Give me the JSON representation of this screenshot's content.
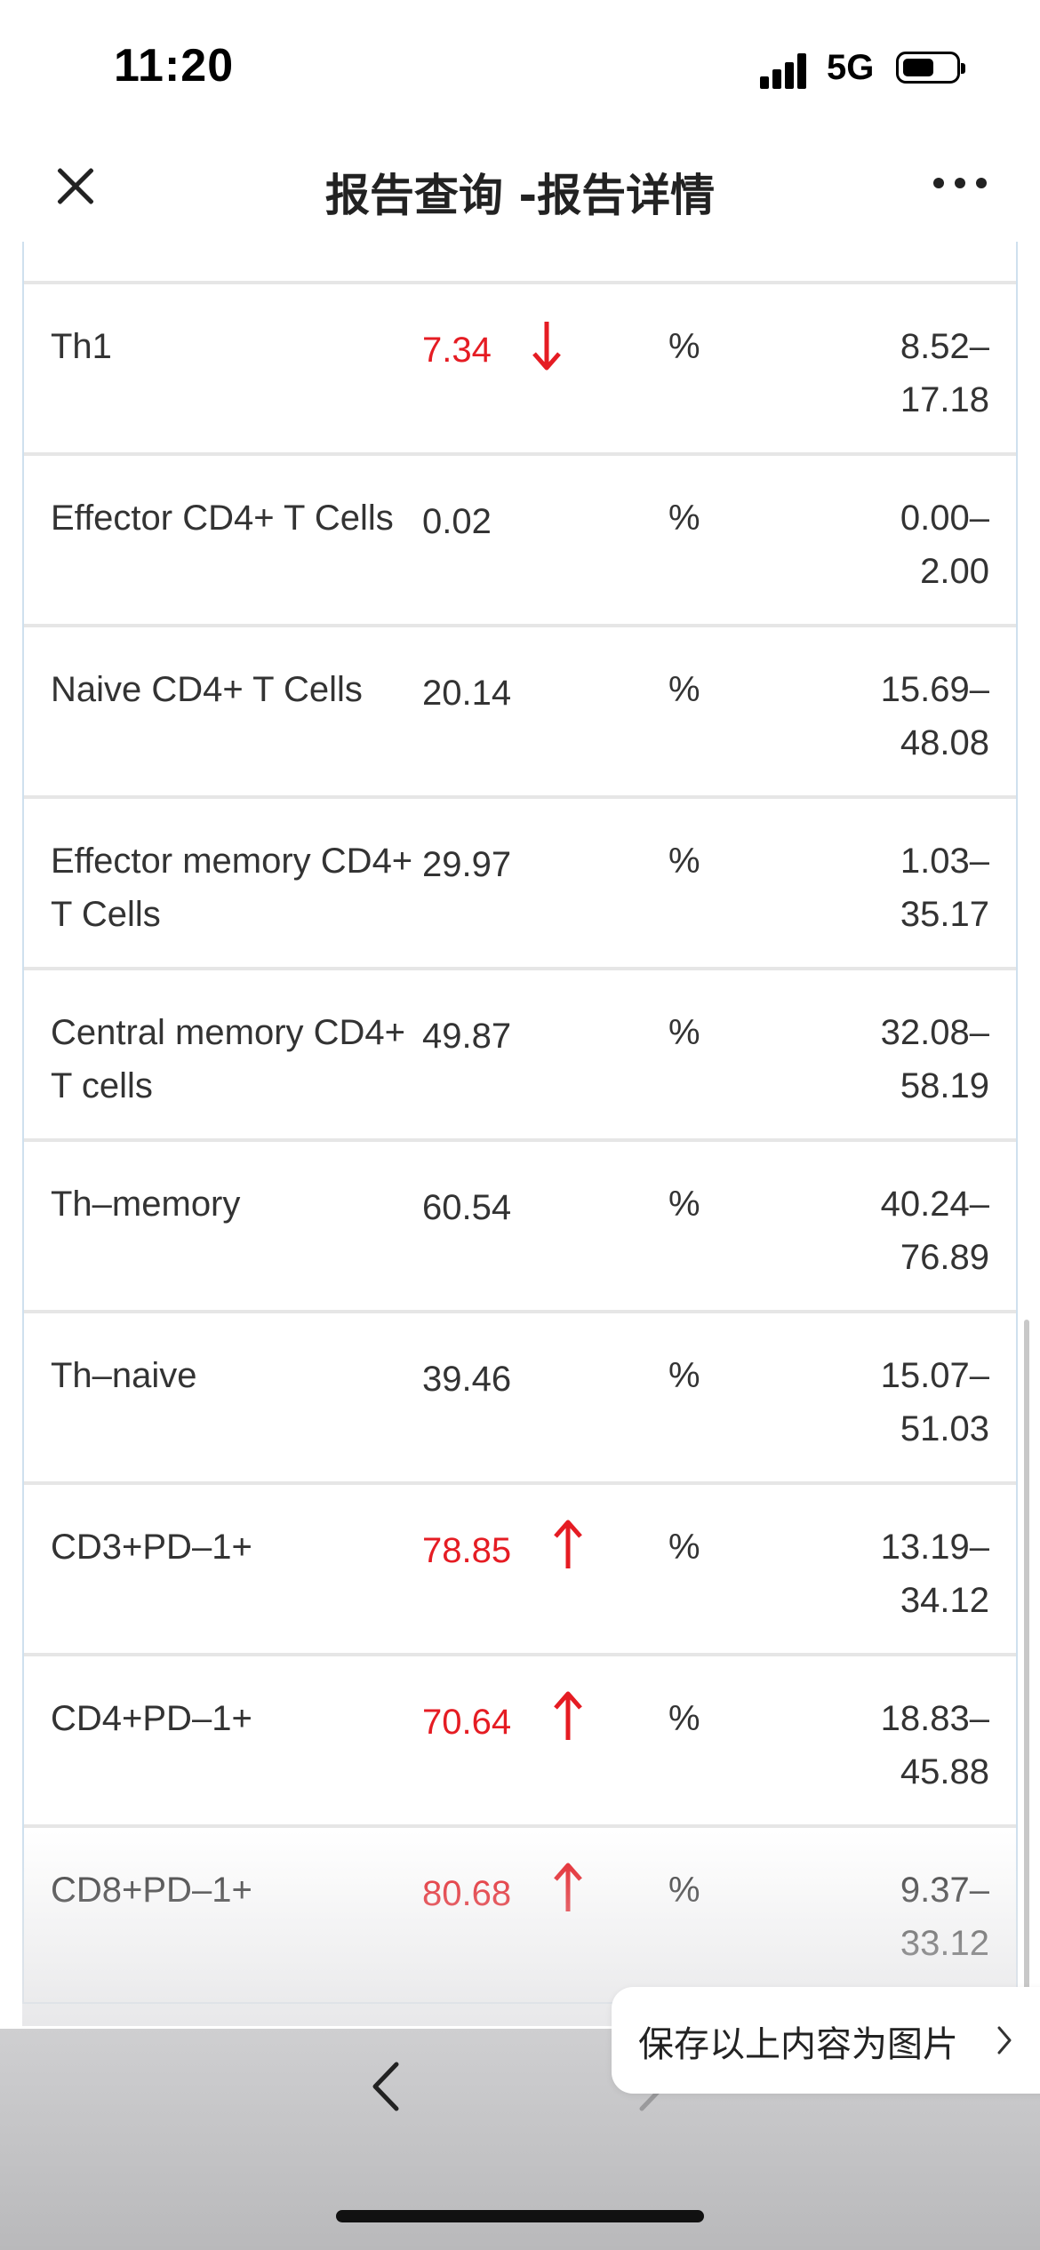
{
  "status_bar": {
    "time": "11:20",
    "network": "5G"
  },
  "nav": {
    "title": "报告查询 -报告详情"
  },
  "rows": [
    {
      "name": "Th1",
      "value": "7.34",
      "flag": "low",
      "unit": "%",
      "range_a": "8.52–",
      "range_b": "17.18"
    },
    {
      "name": "Effector CD4+ T Cells",
      "value": "0.02",
      "flag": "",
      "unit": "%",
      "range_a": "0.00–",
      "range_b": "2.00"
    },
    {
      "name": "Naive CD4+ T Cells",
      "value": "20.14",
      "flag": "",
      "unit": "%",
      "range_a": "15.69–",
      "range_b": "48.08"
    },
    {
      "name": "Effector memory CD4+ T Cells",
      "value": "29.97",
      "flag": "",
      "unit": "%",
      "range_a": "1.03–",
      "range_b": "35.17"
    },
    {
      "name": "Central memory CD4+ T cells",
      "value": "49.87",
      "flag": "",
      "unit": "%",
      "range_a": "32.08–",
      "range_b": "58.19"
    },
    {
      "name": "Th–memory",
      "value": "60.54",
      "flag": "",
      "unit": "%",
      "range_a": "40.24–",
      "range_b": "76.89"
    },
    {
      "name": "Th–naive",
      "value": "39.46",
      "flag": "",
      "unit": "%",
      "range_a": "15.07–",
      "range_b": "51.03"
    },
    {
      "name": "CD3+PD–1+",
      "value": "78.85",
      "flag": "high",
      "unit": "%",
      "range_a": "13.19–",
      "range_b": "34.12"
    },
    {
      "name": "CD4+PD–1+",
      "value": "70.64",
      "flag": "high",
      "unit": "%",
      "range_a": "18.83–",
      "range_b": "45.88"
    },
    {
      "name": "CD8+PD–1+",
      "value": "80.68",
      "flag": "high",
      "unit": "%",
      "range_a": "9.37–",
      "range_b": "33.12"
    }
  ],
  "save_button": {
    "label": "保存以上内容为图片"
  },
  "colors": {
    "abnormal": "#e51c23",
    "border": "#cfe0ee"
  }
}
